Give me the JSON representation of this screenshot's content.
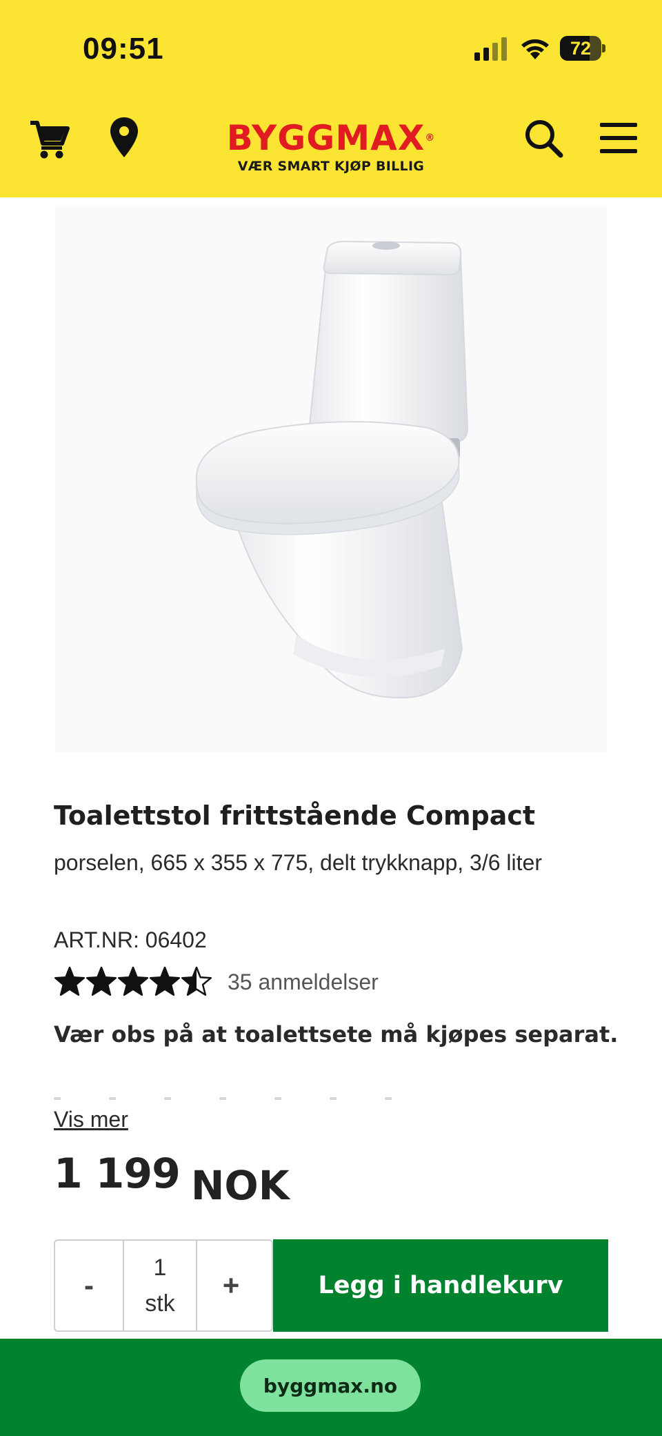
{
  "status_bar": {
    "time": "09:51",
    "battery": "72",
    "battery_level_percent": 72,
    "signal_icon": "cellular-signal-icon",
    "wifi_icon": "wifi-icon"
  },
  "header": {
    "background": "#fbe432",
    "logo_name": "BYGGMAX",
    "logo_tagline": "VÆR SMART KJØP BILLIG",
    "logo_color": "#e11b22",
    "icons": {
      "cart": "shopping-cart-icon",
      "location": "location-pin-icon",
      "search": "search-icon",
      "menu": "hamburger-menu-icon"
    }
  },
  "product": {
    "image_alt": "Toalettstol frittstående Compact",
    "title": "Toalettstol frittstående Compact",
    "subtitle": "porselen, 665 x 355 x 775, delt trykknapp, 3/6 liter",
    "article_number": "ART.NR: 06402",
    "rating": 4.5,
    "rating_max": 5,
    "review_count": "35 anmeldelser",
    "notice": "Vær obs på at toalettsete må kjøpes separat.",
    "show_more": "Vis mer",
    "price_amount": "1 199",
    "price_currency": "NOK"
  },
  "purchase": {
    "decrement": "-",
    "quantity": "1",
    "unit": "stk",
    "increment": "+",
    "add_to_cart": "Legg i handlekurv",
    "button_color": "#00822f"
  },
  "browser": {
    "url": "byggmax.no",
    "bar_color": "#00822f",
    "pill_color": "#7fe19e"
  }
}
